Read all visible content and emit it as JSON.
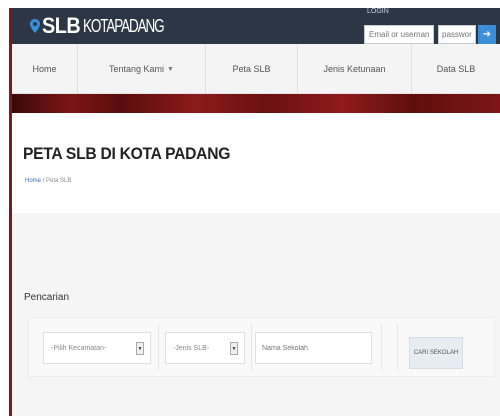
{
  "header": {
    "logo_bold": "SLB",
    "logo_light": "KOTAPADANG",
    "login_label": "LOGIN",
    "email_placeholder": "Email or username",
    "password_placeholder": "password",
    "login_button_icon": "arrow-right-icon"
  },
  "nav": {
    "items": [
      {
        "label": "Home"
      },
      {
        "label": "Tentang Kami",
        "has_dropdown": true
      },
      {
        "label": "Peta SLB"
      },
      {
        "label": "Jenis Ketunaan"
      },
      {
        "label": "Data SLB"
      }
    ]
  },
  "page": {
    "title": "PETA SLB DI KOTA PADANG",
    "breadcrumb_home": "Home",
    "breadcrumb_sep": "/",
    "breadcrumb_current": "Peta SLB"
  },
  "search": {
    "section_label": "Pencarian",
    "kecamatan_selected": "-Pilih Kecamatan-",
    "jenis_selected": "-Jenis SLB-",
    "nama_placeholder": "Nama Sekolah",
    "button_label": "CARI SEKOLAH"
  },
  "colors": {
    "header_bg": "#2b3744",
    "accent_blue": "#3b8fd8",
    "banner_red": "#7f1414"
  }
}
